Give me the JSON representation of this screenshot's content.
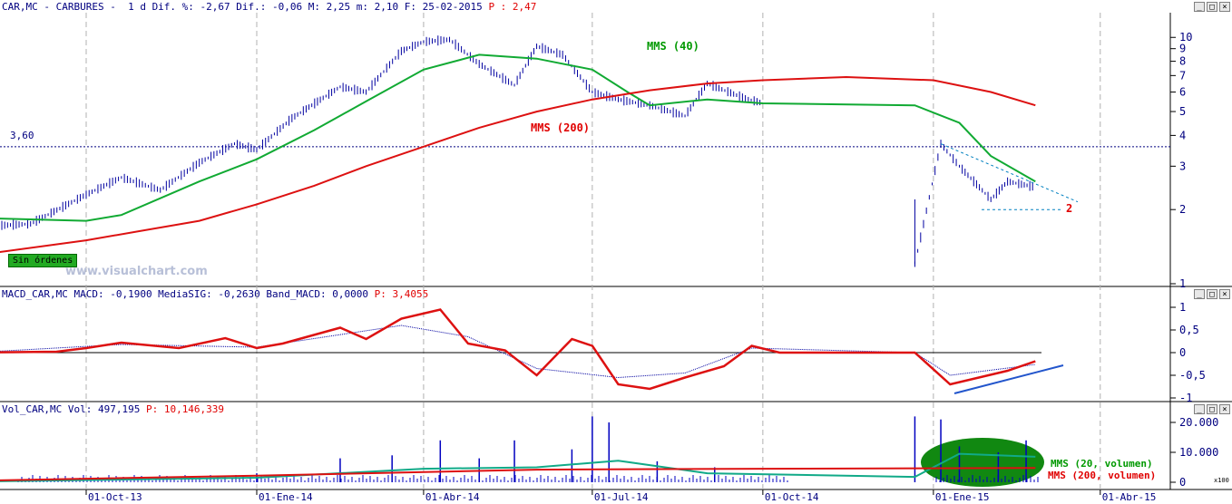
{
  "header": {
    "main": "CAR,MC - CARBURES -  1 d Dif. %: -2,67 Dif.: -0,06 M: 2,25 m: 2,10 F: 25-02-2015",
    "main_price": "P : 2,47",
    "macd": "MACD_CAR,MC MACD: -0,1900 MediaSIG: -0,2630 Band_MACD: 0,0000",
    "macd_price": "P: 3,4055",
    "vol": "Vol_CAR,MC Vol: 497,195",
    "vol_price": "P: 10,146,339"
  },
  "window_buttons": {
    "min": "_",
    "max": "□",
    "close": "×"
  },
  "badge": "Sin órdenes",
  "watermark": "www.visualchart.com",
  "annotations": {
    "level": "3,60",
    "target": "2",
    "sma40": "MMS (40)",
    "sma200": "MMS (200)",
    "vol20": "MMS (20, volumen)",
    "vol200": "MMS (200, volumen)",
    "scale": "x100"
  },
  "chart_data": [
    {
      "type": "line",
      "title": "CAR,MC - CARBURES - 1 d",
      "log_scale": true,
      "ylim": [
        1,
        11
      ],
      "y_ticks": [
        "1",
        "2",
        "3",
        "4",
        "5",
        "6",
        "7",
        "8",
        "9",
        "10"
      ],
      "x_ticks": [
        "01-Oct-13",
        "01-Ene-14",
        "01-Abr-14",
        "01-Jul-14",
        "01-Oct-14",
        "01-Ene-15",
        "01-Abr-15"
      ],
      "horizontal_level": 3.6,
      "series": [
        {
          "name": "Price",
          "x": [
            "2013-08-01",
            "2013-09-01",
            "2013-10-01",
            "2013-10-20",
            "2013-11-10",
            "2013-12-01",
            "2013-12-20",
            "2014-01-01",
            "2014-01-20",
            "2014-02-15",
            "2014-03-01",
            "2014-03-20",
            "2014-04-01",
            "2014-04-15",
            "2014-05-01",
            "2014-05-20",
            "2014-06-01",
            "2014-06-15",
            "2014-07-01",
            "2014-07-15",
            "2014-08-01",
            "2014-08-20",
            "2014-09-01",
            "2014-09-20",
            "2014-10-01",
            "2014-12-22",
            "2015-01-05",
            "2015-01-15",
            "2015-02-01",
            "2015-02-10",
            "2015-02-25"
          ],
          "values": [
            1.7,
            1.75,
            2.3,
            2.7,
            2.4,
            3.1,
            3.7,
            3.5,
            4.7,
            6.3,
            6.0,
            8.8,
            9.6,
            9.8,
            7.8,
            6.4,
            9.2,
            8.5,
            6.0,
            5.6,
            5.3,
            4.8,
            6.5,
            5.7,
            5.4,
            1.2,
            3.7,
            3.0,
            2.2,
            2.6,
            2.47
          ]
        },
        {
          "name": "MMS (40)",
          "x": [
            "2013-08-01",
            "2013-10-01",
            "2013-10-20",
            "2013-12-01",
            "2014-01-01",
            "2014-02-01",
            "2014-03-01",
            "2014-04-01",
            "2014-05-01",
            "2014-06-01",
            "2014-07-01",
            "2014-07-20",
            "2014-08-01",
            "2014-09-01",
            "2014-10-01",
            "2014-12-22",
            "2015-01-15",
            "2015-02-01",
            "2015-02-25"
          ],
          "values": [
            1.85,
            1.8,
            1.9,
            2.6,
            3.2,
            4.2,
            5.5,
            7.4,
            8.5,
            8.2,
            7.4,
            6.0,
            5.3,
            5.6,
            5.4,
            5.3,
            4.5,
            3.3,
            2.6
          ]
        },
        {
          "name": "MMS (200)",
          "x": [
            "2013-08-01",
            "2013-10-01",
            "2013-12-01",
            "2014-01-01",
            "2014-02-01",
            "2014-03-01",
            "2014-04-01",
            "2014-05-01",
            "2014-06-01",
            "2014-07-01",
            "2014-08-01",
            "2014-09-01",
            "2014-10-01",
            "2014-11-15",
            "2015-01-01",
            "2015-02-01",
            "2015-02-25"
          ],
          "values": [
            1.3,
            1.5,
            1.8,
            2.1,
            2.5,
            3.0,
            3.6,
            4.3,
            5.0,
            5.6,
            6.1,
            6.5,
            6.7,
            6.9,
            6.7,
            6.0,
            5.3
          ]
        }
      ]
    },
    {
      "type": "line",
      "title": "MACD_CAR,MC",
      "ylim": [
        -1,
        1
      ],
      "y_ticks": [
        "1",
        "0,5",
        "0",
        "-0,5",
        "-1"
      ],
      "series": [
        {
          "name": "MACD",
          "x": [
            "2013-08-01",
            "2013-09-15",
            "2013-10-01",
            "2013-10-20",
            "2013-11-20",
            "2013-12-15",
            "2014-01-01",
            "2014-01-15",
            "2014-02-15",
            "2014-03-01",
            "2014-03-20",
            "2014-04-10",
            "2014-04-25",
            "2014-05-15",
            "2014-06-01",
            "2014-06-20",
            "2014-07-01",
            "2014-07-15",
            "2014-08-01",
            "2014-08-20",
            "2014-09-10",
            "2014-09-25",
            "2014-10-10",
            "2014-12-22",
            "2015-01-10",
            "2015-02-10",
            "2015-02-25"
          ],
          "values": [
            0,
            0.02,
            0.1,
            0.22,
            0.1,
            0.32,
            0.1,
            0.2,
            0.55,
            0.3,
            0.75,
            0.95,
            0.2,
            0.05,
            -0.5,
            0.3,
            0.15,
            -0.7,
            -0.8,
            -0.55,
            -0.3,
            0.15,
            0,
            0,
            -0.7,
            -0.4,
            -0.19
          ]
        },
        {
          "name": "MediaSIG",
          "x": [
            "2013-08-01",
            "2013-10-20",
            "2014-01-01",
            "2014-03-20",
            "2014-04-25",
            "2014-06-01",
            "2014-07-15",
            "2014-08-20",
            "2014-09-25",
            "2014-12-22",
            "2015-01-10",
            "2015-02-25"
          ],
          "values": [
            0,
            0.18,
            0.12,
            0.6,
            0.35,
            -0.35,
            -0.55,
            -0.45,
            0.1,
            0,
            -0.5,
            -0.263
          ]
        }
      ]
    },
    {
      "type": "bar",
      "title": "Vol_CAR,MC",
      "ylim": [
        0,
        23000
      ],
      "y_ticks": [
        "20.000",
        "10.000",
        "0"
      ],
      "series": [
        {
          "name": "Vol",
          "x": [
            "2014-01-01",
            "2014-02-15",
            "2014-03-15",
            "2014-04-10",
            "2014-05-01",
            "2014-05-20",
            "2014-06-20",
            "2014-07-01",
            "2014-07-10",
            "2014-08-05",
            "2014-09-05",
            "2014-12-22",
            "2015-01-05",
            "2015-01-15",
            "2015-02-05",
            "2015-02-20"
          ],
          "values": [
            3000,
            8000,
            9000,
            14000,
            8000,
            14000,
            11000,
            22000,
            20000,
            7000,
            5000,
            22000,
            21000,
            12000,
            10000,
            14000
          ]
        },
        {
          "name": "MMS (20, volumen)",
          "x": [
            "2013-08-01",
            "2014-01-01",
            "2014-04-01",
            "2014-06-01",
            "2014-07-15",
            "2014-09-01",
            "2014-12-22",
            "2015-01-15",
            "2015-02-25"
          ],
          "values": [
            200,
            1500,
            4500,
            5000,
            7200,
            3000,
            1800,
            9500,
            8500
          ]
        },
        {
          "name": "MMS (200, volumen)",
          "x": [
            "2013-08-01",
            "2014-01-01",
            "2014-06-01",
            "2014-10-01",
            "2015-02-25"
          ],
          "values": [
            500,
            2200,
            4200,
            4500,
            4800
          ]
        }
      ]
    }
  ]
}
